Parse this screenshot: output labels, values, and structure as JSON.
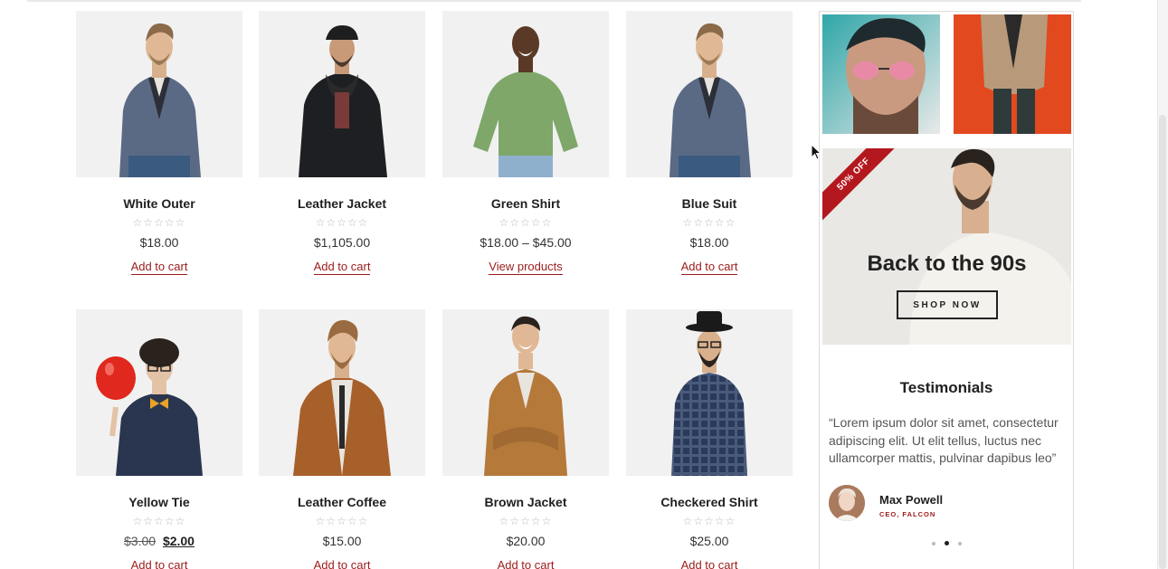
{
  "products": [
    {
      "name": "White Outer",
      "stars": "☆☆☆☆☆",
      "price": "$18.00",
      "action": "Add to cart",
      "image": "man-in-grey-blazer"
    },
    {
      "name": "Leather Jacket",
      "stars": "☆☆☆☆☆",
      "price": "$1,105.00",
      "action": "Add to cart",
      "image": "man-in-black-coat-and-cap"
    },
    {
      "name": "Green Shirt",
      "stars": "☆☆☆☆☆",
      "price": "$18.00 – $45.00",
      "action": "View products",
      "image": "man-in-green-shirt"
    },
    {
      "name": "Blue Suit",
      "stars": "☆☆☆☆☆",
      "price": "$18.00",
      "action": "Add to cart",
      "image": "man-in-grey-blazer"
    },
    {
      "name": "Yellow Tie",
      "stars": "☆☆☆☆☆",
      "price_old": "$3.00",
      "price_new": "$2.00",
      "action": "Add to cart",
      "image": "man-with-red-balloon"
    },
    {
      "name": "Leather Coffee",
      "stars": "☆☆☆☆☆",
      "price": "$15.00",
      "action": "Add to cart",
      "image": "man-in-brown-leather-jacket"
    },
    {
      "name": "Brown Jacket",
      "stars": "☆☆☆☆☆",
      "price": "$20.00",
      "action": "Add to cart",
      "image": "man-in-camel-jacket"
    },
    {
      "name": "Checkered Shirt",
      "stars": "☆☆☆☆☆",
      "price": "$25.00",
      "action": "Add to cart",
      "image": "man-in-checkered-shirt-and-hat"
    }
  ],
  "sidebar": {
    "promo": {
      "badge": "50% OFF",
      "title": "Back to the 90s",
      "button": "SHOP NOW"
    },
    "testimonials": {
      "title": "Testimonials",
      "quote": "“Lorem ipsum dolor sit amet, consectetur adipiscing elit. Ut elit tellus, luctus nec ullamcorper mattis, pulvinar dapibus leo”",
      "author": "Max Powell",
      "role": "CEO, FALCON",
      "active_slide": 2,
      "slide_count": 3
    }
  },
  "colors": {
    "accent": "#9b1b1b",
    "ribbon": "#b3181e",
    "thumb_bg": "#f1f1f1"
  }
}
